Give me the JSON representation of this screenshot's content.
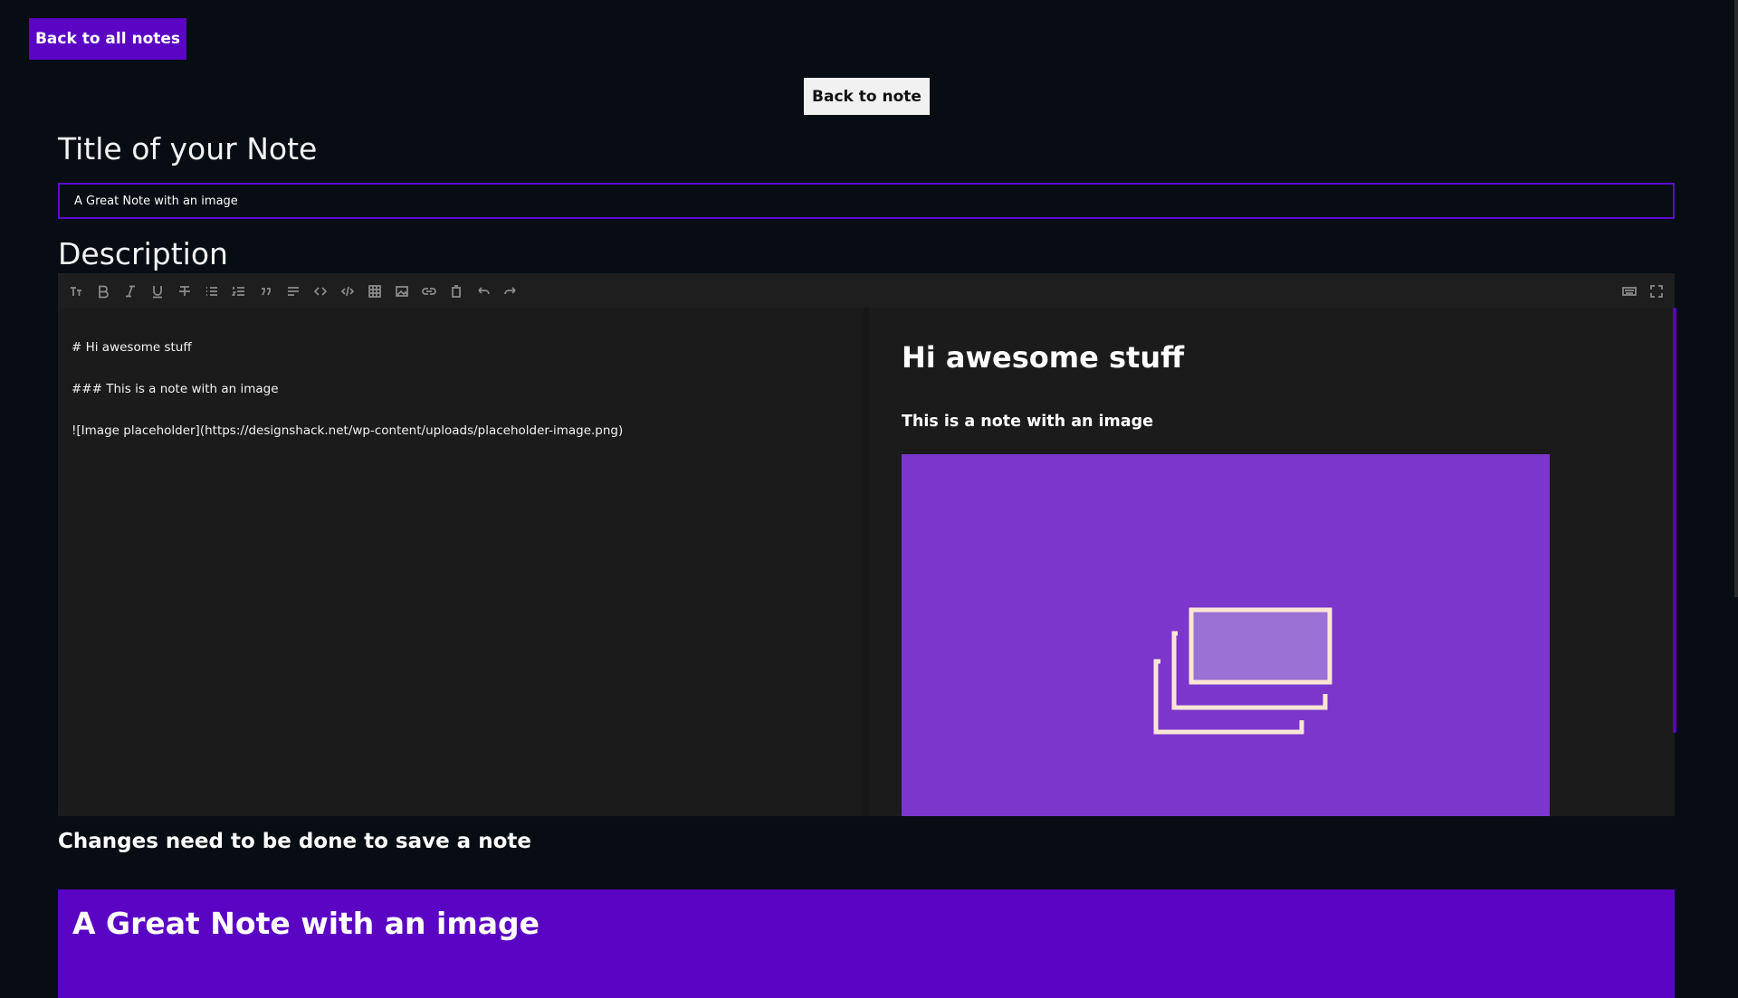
{
  "nav": {
    "back_all_label": "Back to all notes",
    "back_note_label": "Back to note"
  },
  "form": {
    "title_label": "Title of your Note",
    "title_value": "A Great Note with an image",
    "description_label": "Description"
  },
  "editor": {
    "toolbar_icons": [
      "heading-icon",
      "bold-icon",
      "italic-icon",
      "underline-icon",
      "strikethrough-icon",
      "bullet-list-icon",
      "ordered-list-icon",
      "quote-icon",
      "horizontal-rule-icon",
      "inline-code-icon",
      "code-block-icon",
      "table-icon",
      "image-icon",
      "link-icon",
      "clear-icon",
      "undo-icon",
      "redo-icon",
      "keyboard-icon",
      "fullscreen-icon"
    ],
    "source_lines": [
      "# Hi awesome stuff",
      "### This is a note with an image",
      "![Image placeholder](https://designshack.net/wp-content/uploads/placeholder-image.png)"
    ],
    "preview": {
      "h1": "Hi awesome stuff",
      "h3": "This is a note with an image",
      "image_alt": "Image placeholder"
    }
  },
  "status": {
    "notice": "Changes need to be done to save a note"
  },
  "card": {
    "title": "A Great Note with an image"
  },
  "colors": {
    "background": "#070d12",
    "accent": "#5a04c4",
    "editor_bg": "#1b1b1c",
    "placeholder_bg": "#7b36cc"
  }
}
